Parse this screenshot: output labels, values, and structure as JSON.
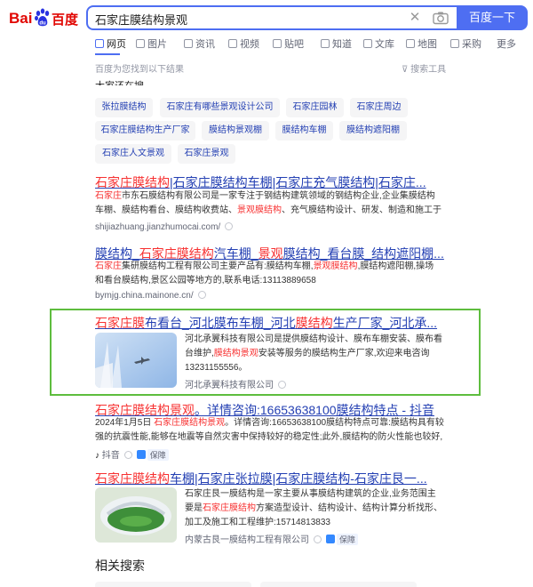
{
  "header": {
    "logo_bai": "Bai",
    "logo_du": "百度",
    "query": "石家庄膜结构景观",
    "search_button": "百度一下"
  },
  "tabs": [
    {
      "label": "网页",
      "icon": "web-icon"
    },
    {
      "label": "图片",
      "icon": "image-icon"
    },
    {
      "label": "资讯",
      "icon": "news-icon"
    },
    {
      "label": "视频",
      "icon": "video-icon"
    },
    {
      "label": "贴吧",
      "icon": "tieba-icon"
    },
    {
      "label": "知道",
      "icon": "zhidao-icon"
    },
    {
      "label": "文库",
      "icon": "wenku-icon"
    },
    {
      "label": "地图",
      "icon": "map-icon"
    },
    {
      "label": "采购",
      "icon": "purchase-icon"
    },
    {
      "label": "更多",
      "icon": ""
    }
  ],
  "found_text": "百度为您找到以下结果",
  "tools_text": "搜索工具",
  "related_head": "大家还在搜",
  "chips": [
    "张拉膜结构",
    "石家庄有哪些景观设计公司",
    "石家庄园林",
    "石家庄周边",
    "石家庄膜结构生产厂家",
    "膜结构景观棚",
    "膜结构车棚",
    "膜结构遮阳棚",
    "石家庄人文景观",
    "石家庄景观"
  ],
  "results": [
    {
      "title_parts": [
        {
          "t": "石家庄膜结构",
          "em": true
        },
        {
          "t": "|石家庄膜结构车棚|石家庄充气膜结构|石家庄...",
          "em": false
        }
      ],
      "abstract_parts": [
        {
          "t": "石家庄",
          "em": true
        },
        {
          "t": "市东石膜结构有限公司是一家专注于钢结构建筑领域的钢结构企业,企业集膜结构车棚、膜结构看台、膜结构收费站、",
          "em": false
        },
        {
          "t": "景观膜结构",
          "em": true
        },
        {
          "t": "、充气膜结构设计、研发、制造和施工于一体股...",
          "em": false
        }
      ],
      "source": "shijiazhuang.jianzhumocai.com/"
    },
    {
      "title_parts": [
        {
          "t": "膜结构_",
          "em": false
        },
        {
          "t": "石家庄膜结构",
          "em": true
        },
        {
          "t": "汽车棚_",
          "em": false
        },
        {
          "t": "景观",
          "em": true
        },
        {
          "t": "膜结构_看台膜_结构遮阳棚...",
          "em": false
        }
      ],
      "abstract_parts": [
        {
          "t": "石家庄",
          "em": true
        },
        {
          "t": "集研膜结构工程有限公司主要产品有:膜结构车棚,",
          "em": false
        },
        {
          "t": "景观膜结构",
          "em": true
        },
        {
          "t": ",膜结构遮阳棚,操场和看台膜结构,景区公园等地方的,联系电话:13113889658",
          "em": false
        }
      ],
      "source": "bymjg.china.mainone.cn/"
    },
    {
      "title_parts": [
        {
          "t": "石家庄膜",
          "em": true
        },
        {
          "t": "布看台_河北膜布车棚_河北",
          "em": false
        },
        {
          "t": "膜结构",
          "em": true
        },
        {
          "t": "生产厂家_河北承...",
          "em": false
        }
      ],
      "abstract_parts": [
        {
          "t": "河北承翼科技有限公司是提供膜结构设计、膜布车棚安装、膜布看台维护,",
          "em": false
        },
        {
          "t": "膜结构景观",
          "em": true
        },
        {
          "t": "安装等服务的膜结构生产厂家,欢迎来电咨询13231155556。",
          "em": false
        }
      ],
      "source": "河北承翼科技有限公司"
    },
    {
      "title_parts": [
        {
          "t": "石家庄膜结构景观",
          "em": true
        },
        {
          "t": "。详情咨询:16653638100膜结构特点 - 抖音",
          "em": false
        }
      ],
      "abstract_parts": [
        {
          "t": "2024年1月5日 ",
          "em": false
        },
        {
          "t": "石家庄膜结构景观",
          "em": true
        },
        {
          "t": "。详情咨询:16653638100膜结构特点可靠:膜结构具有较强的抗震性能,能够在地震等自然灾害中保持较好的稳定性;此外,膜结构的防火性能也较好,可以...",
          "em": false
        }
      ],
      "source": "抖音",
      "badge": "保障"
    },
    {
      "title_parts": [
        {
          "t": "石家庄膜结构",
          "em": true
        },
        {
          "t": "车棚|石家庄张拉膜|石家庄膜结构-石家庄艮一...",
          "em": false
        }
      ],
      "abstract_parts": [
        {
          "t": "石家庄艮一膜结构是一家主要从事膜结构建筑的企业,业务范围主要是",
          "em": false
        },
        {
          "t": "石家庄膜结构",
          "em": true
        },
        {
          "t": "方案造型设计、结构设计、结构计算分析找形、加工及施工和工程维护:15714813833",
          "em": false
        }
      ],
      "source": "内蒙古艮一膜结构工程有限公司",
      "badge": "保障"
    }
  ],
  "related_bottom": "相关搜索",
  "colors": {
    "brand_blue": "#4e6ef2",
    "highlight_red": "#f73131",
    "link_blue": "#2440b3",
    "box_green": "#5ebd3e"
  }
}
